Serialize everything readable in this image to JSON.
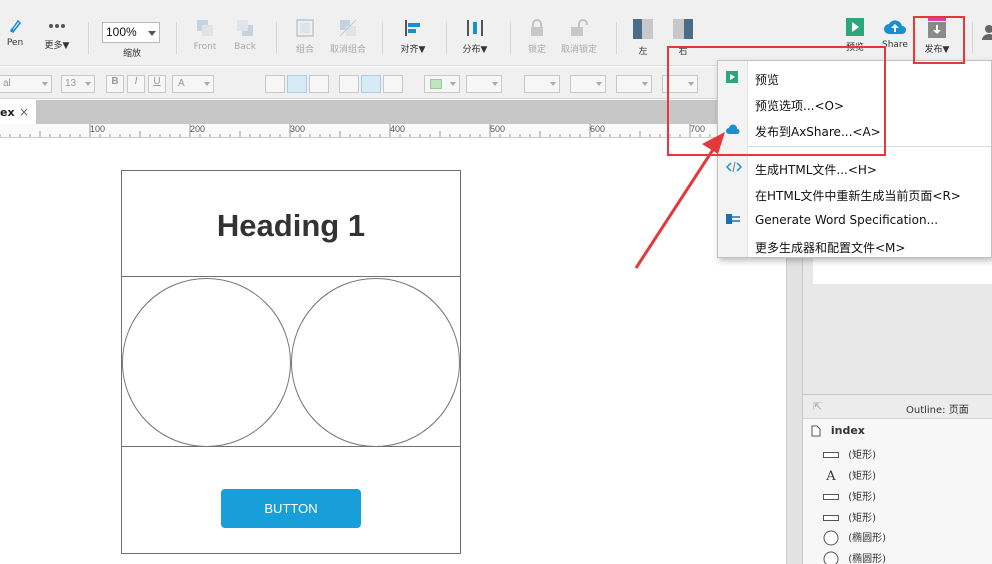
{
  "toolbar": {
    "pen": "Pen",
    "more": "更多▼",
    "zoom_value": "100%",
    "zoom_label": "缩放",
    "front": "Front",
    "back": "Back",
    "group": "组合",
    "ungroup": "取消组合",
    "align": "对齐▼",
    "distribute": "分布▼",
    "lock": "锁定",
    "unlock": "取消锁定",
    "left": "左",
    "right": "右",
    "preview": "预览",
    "share": "Share",
    "publish": "发布▼"
  },
  "format_bar": {
    "font_family": "al",
    "font_size": "13",
    "bold": "B",
    "italic": "I",
    "underline": "U",
    "font_color": "A"
  },
  "tab": {
    "label": "ex",
    "close": "×"
  },
  "ruler": {
    "labels": [
      "100",
      "200",
      "300",
      "400",
      "500",
      "600",
      "700"
    ]
  },
  "canvas": {
    "heading": "Heading 1",
    "button_label": "BUTTON"
  },
  "publish_menu": {
    "items": [
      {
        "label": "预览",
        "icon": "play-icon"
      },
      {
        "label": "预览选项...<O>",
        "icon": ""
      },
      {
        "label": "发布到AxShare...<A>",
        "icon": "cloud-icon"
      },
      {
        "label": "生成HTML文件...<H>",
        "icon": "code-icon"
      },
      {
        "label": "在HTML文件中重新生成当前页面<R>",
        "icon": ""
      },
      {
        "label": "Generate Word Specification...",
        "icon": "word-doc-icon"
      },
      {
        "label": "更多生成器和配置文件<M>",
        "icon": ""
      }
    ]
  },
  "outline": {
    "title": "Outline: 页面",
    "root": "index",
    "items": [
      {
        "label": "(矩形)",
        "icon": "rectangle-icon"
      },
      {
        "label": "(矩形)",
        "icon": "text-icon"
      },
      {
        "label": "(矩形)",
        "icon": "rectangle-icon"
      },
      {
        "label": "(矩形)",
        "icon": "rectangle-icon"
      },
      {
        "label": "(椭圆形)",
        "icon": "ellipse-icon"
      },
      {
        "label": "(椭圆形)",
        "icon": "ellipse-icon"
      }
    ]
  },
  "colors": {
    "accent": "#189fd9",
    "annotation": "#e5383b",
    "publish_icon": "#e040a0"
  }
}
